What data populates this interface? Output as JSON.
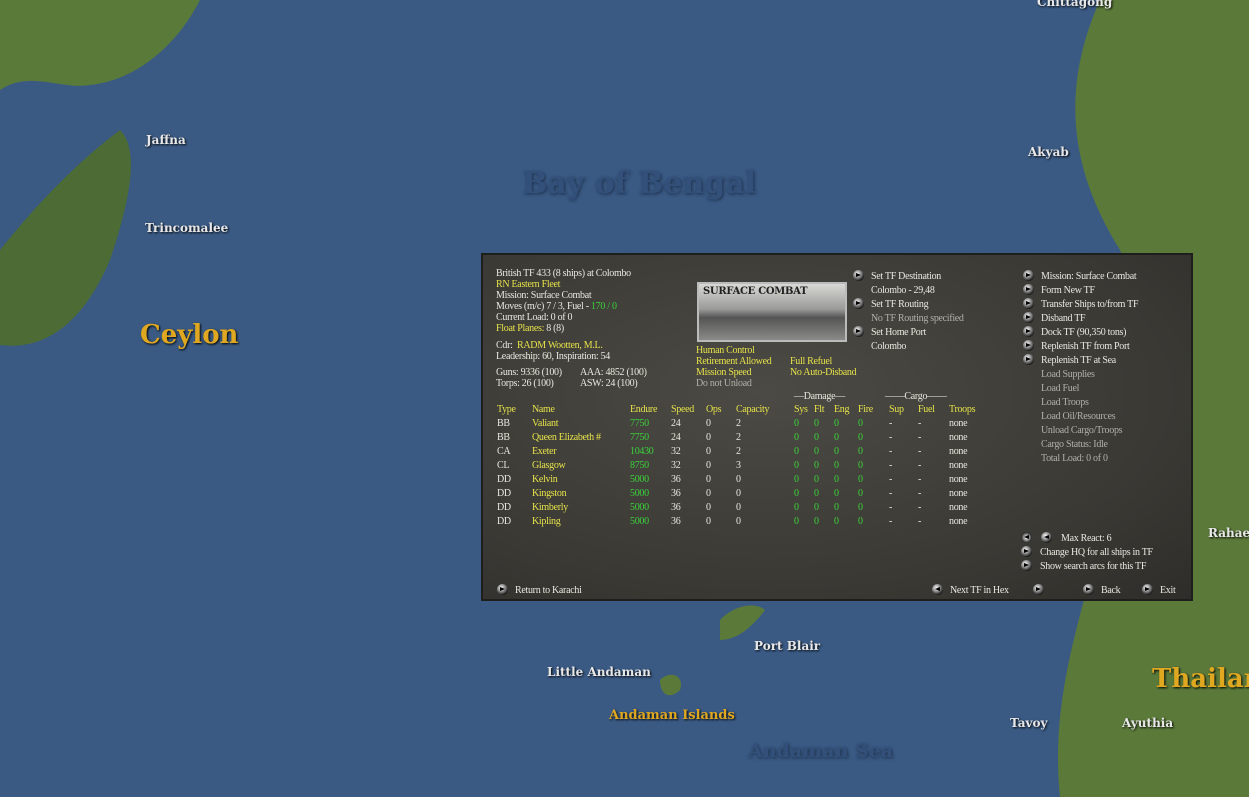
{
  "map": {
    "labels": {
      "chittagong": "Chittagong",
      "jaffna": "Jaffna",
      "trincomalee": "Trincomalee",
      "ceylon": "Ceylon",
      "bay": "Bay of Bengal",
      "akyab": "Akyab",
      "port_blair": "Port Blair",
      "little_andaman": "Little Andaman",
      "andaman_islands": "Andaman Islands",
      "andaman_sea": "Andaman Sea",
      "tavoy": "Tavoy",
      "ayuthia": "Ayuthia",
      "thailand": "Thailan",
      "rahaeng": "Rahaen"
    }
  },
  "info": {
    "title": "British TF 433 (8 ships) at Colombo",
    "fleet": "RN Eastern Fleet",
    "mission": "Mission:  Surface Combat",
    "moves": "Moves (m/c)  7 / 3, Fuel - ",
    "fuel": "170 / 0",
    "load": "Current Load:  0 of 0",
    "float_planes": "Float Planes: ",
    "float_val": "8 (8)",
    "cdr_label": "Cdr:",
    "cdr": "RADM  Wootten, M.L.",
    "leadership": "Leadership: 60, Inspiration: 54",
    "guns": "Guns: 9336 (100)",
    "aaa": "AAA: 4852 (100)",
    "torps": "Torps: 26 (100)",
    "asw": "ASW: 24 (100)"
  },
  "picture_title": "SURFACE COMBAT",
  "settings": {
    "human": "Human Control",
    "retire": "Retirement Allowed",
    "speed": "Mission Speed",
    "unload": "Do not Unload",
    "refuel": "Full Refuel",
    "disband": "No Auto-Disband"
  },
  "dest": {
    "set_dest": "Set TF Destination",
    "dest_val": "Colombo - 29,48",
    "set_routing": "Set TF Routing",
    "routing_val": "No TF Routing specified",
    "set_home": "Set Home Port",
    "home_val": "Colombo"
  },
  "actions": [
    "Mission: Surface Combat",
    "Form New TF",
    "Transfer Ships to/from TF",
    "Disband TF",
    "Dock TF (90,350 tons)",
    "Replenish TF from Port",
    "Replenish TF at Sea"
  ],
  "cargo_actions": [
    "Load Supplies",
    "Load Fuel",
    "Load Troops",
    "Load Oil/Resources",
    "Unload Cargo/Troops",
    "Cargo Status: Idle",
    "Total Load: 0 of 0"
  ],
  "table": {
    "group_damage": "—Damage—",
    "group_cargo": "——Cargo——",
    "headers": [
      "Type",
      "Name",
      "Endure",
      "Speed",
      "Ops",
      "Capacity",
      "Sys",
      "Flt",
      "Eng",
      "Fire",
      "Sup",
      "Fuel",
      "Troops"
    ],
    "rows": [
      [
        "BB",
        "Valiant",
        "7750",
        "24",
        "0",
        "2",
        "0",
        "0",
        "0",
        "0",
        "-",
        "-",
        "none"
      ],
      [
        "BB",
        "Queen Elizabeth #",
        "7750",
        "24",
        "0",
        "2",
        "0",
        "0",
        "0",
        "0",
        "-",
        "-",
        "none"
      ],
      [
        "CA",
        "Exeter",
        "10430",
        "32",
        "0",
        "2",
        "0",
        "0",
        "0",
        "0",
        "-",
        "-",
        "none"
      ],
      [
        "CL",
        "Glasgow",
        "8750",
        "32",
        "0",
        "3",
        "0",
        "0",
        "0",
        "0",
        "-",
        "-",
        "none"
      ],
      [
        "DD",
        "Kelvin",
        "5000",
        "36",
        "0",
        "0",
        "0",
        "0",
        "0",
        "0",
        "-",
        "-",
        "none"
      ],
      [
        "DD",
        "Kingston",
        "5000",
        "36",
        "0",
        "0",
        "0",
        "0",
        "0",
        "0",
        "-",
        "-",
        "none"
      ],
      [
        "DD",
        "Kimberly",
        "5000",
        "36",
        "0",
        "0",
        "0",
        "0",
        "0",
        "0",
        "-",
        "-",
        "none"
      ],
      [
        "DD",
        "Kipling",
        "5000",
        "36",
        "0",
        "0",
        "0",
        "0",
        "0",
        "0",
        "-",
        "-",
        "none"
      ]
    ]
  },
  "bottom": {
    "max_react": "Max React: 6",
    "change_hq": "Change HQ for all ships in TF",
    "search_arcs": "Show search arcs for this TF",
    "return": "Return to Karachi",
    "next_tf": "Next TF in Hex",
    "back": "Back",
    "exit": "Exit"
  }
}
